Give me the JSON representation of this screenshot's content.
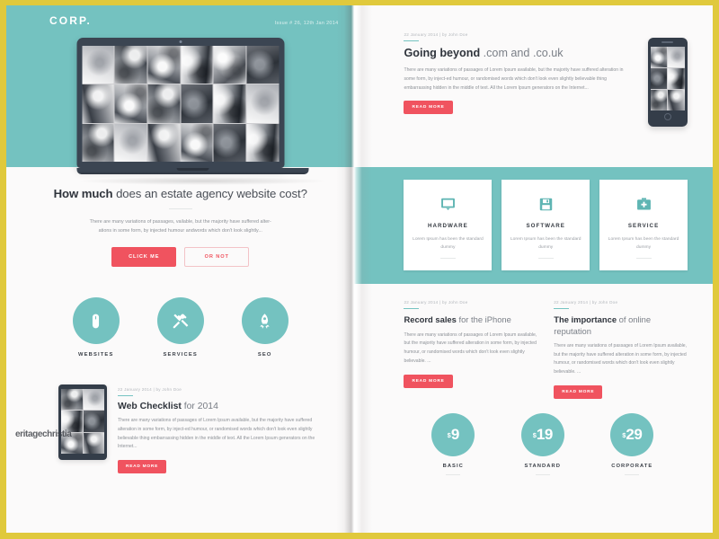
{
  "theme": {
    "frame_color": "#e0c93c",
    "teal": "#74c2c0",
    "accent_red": "#f0535f",
    "page_bg": "#fbfafa",
    "dark_text": "#2f343c",
    "muted_text": "#8d9197"
  },
  "left_page": {
    "logo": "CORP.",
    "issue": "Issue # 26, 12th Jan 2014",
    "hero_feature": {
      "intro_bold": "How much",
      "intro_rest": " does an estate agency website cost?",
      "lead": "There are many variations of passages, vailable, but the majority have suffered alter-ations in some form, by injected humour andwords which don't look slightly...",
      "primary_button": "CLICK ME",
      "secondary_button": "OR NOT"
    },
    "services": [
      {
        "label": "WEBSITES",
        "icon": "mouse-icon"
      },
      {
        "label": "SERVICES",
        "icon": "tools-icon"
      },
      {
        "label": "SEO",
        "icon": "rocket-icon"
      }
    ],
    "article": {
      "meta": "22 January 2014  |  by John Doe",
      "title_bold": "Web Checklist",
      "title_rest": " for 2014",
      "text": "There are many variations of passages of Lorem Ipsum available, but the majority have suffered alteration in some form, by inject-ed humour, or randomised words which don't look even slightly believable thing embarrassing hidden in the middle of text. All the Lorem Ipsum generators on the Internet...",
      "button": "READ MORE"
    },
    "watermark": "eritagechristia"
  },
  "right_page": {
    "hero_article": {
      "meta": "22 January 2014  |  by John Doe",
      "title_bold": "Going beyond",
      "title_rest": " .com and .co.uk",
      "text": "There are many variations of passages of Lorem Ipsum available, but the majority have suffered alteration in some form, by inject-ed humour, or randomised words which don't look even slightly believable thing embarrassing hidden in the middle of text. All the Lorem Ipsum generators on the Internet...",
      "button": "READ MORE"
    },
    "feature_cards": [
      {
        "title": "HARDWARE",
        "text": "Lorem Ipsum has been the standard dummy",
        "icon": "monitor-icon"
      },
      {
        "title": "SOFTWARE",
        "text": "Lorem Ipsum has been the standard dummy",
        "icon": "floppy-disk-icon"
      },
      {
        "title": "SERVICE",
        "text": "Lorem Ipsum has been the standard dummy",
        "icon": "first-aid-kit-icon"
      }
    ],
    "articles": [
      {
        "meta": "22 January 2014  |  by John Doe",
        "title_bold": "Record sales",
        "title_rest": " for the iPhone",
        "text": "There are many variations of passages of Lorem Ipsum available, but the majority have suffered alteration in some form, by injected humour, or randomised words which don't look even slightly believable. ...",
        "button": "READ MORE"
      },
      {
        "meta": "22 January 2014  |  by John Doe",
        "title_bold": "The importance",
        "title_rest": " of online reputation",
        "text": "There are many variations of passages of Lorem Ipsum available, but the majority have suffered alteration in some form, by injected humour, or randomised words which don't look even slightly believable. ...",
        "button": "READ MORE"
      }
    ],
    "pricing": [
      {
        "currency": "$",
        "amount": "9",
        "label": "BASIC"
      },
      {
        "currency": "$",
        "amount": "19",
        "label": "STANDARD"
      },
      {
        "currency": "$",
        "amount": "29",
        "label": "CORPORATE"
      }
    ]
  }
}
